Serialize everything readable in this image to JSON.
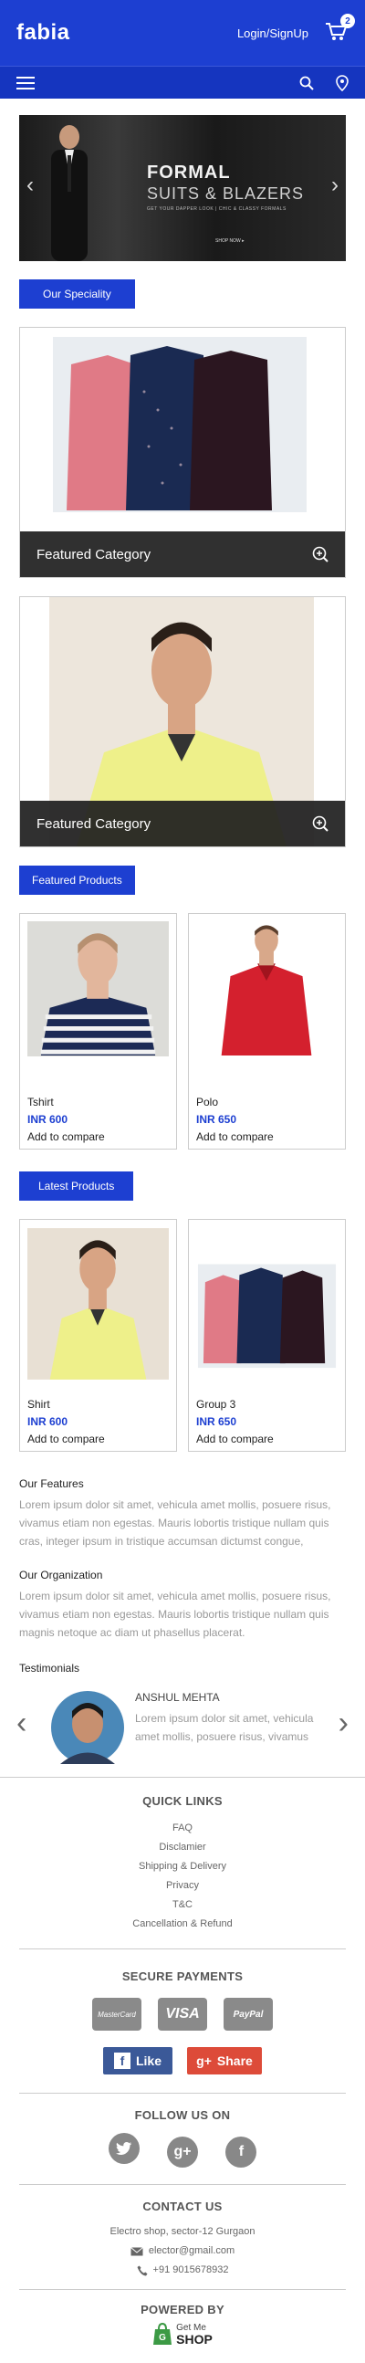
{
  "header": {
    "logo": "fabia",
    "login": "Login/SignUp",
    "cart_count": "2"
  },
  "banner": {
    "title": "FORMAL",
    "subtitle": "SUITS & BLAZERS",
    "tagline": "GET YOUR DAPPER LOOK | CHIC & CLASSY FORMALS",
    "cta": "SHOP NOW ▸"
  },
  "specialty": {
    "button": "Our Speciality",
    "cards": [
      {
        "label": "Featured Category"
      },
      {
        "label": "Featured Category"
      }
    ]
  },
  "featured_products": {
    "button": "Featured Products",
    "items": [
      {
        "name": "Tshirt",
        "price": "INR 600",
        "compare": "Add to compare"
      },
      {
        "name": "Polo",
        "price": "INR 650",
        "compare": "Add to compare"
      }
    ]
  },
  "latest_products": {
    "button": "Latest Products",
    "items": [
      {
        "name": "Shirt",
        "price": "INR 600",
        "compare": "Add to compare"
      },
      {
        "name": "Group 3",
        "price": "INR 650",
        "compare": "Add to compare"
      }
    ]
  },
  "features": {
    "heading": "Our Features",
    "text": "Lorem ipsum dolor sit amet, vehicula amet mollis, posuere risus, vivamus etiam non egestas. Mauris lobortis tristique nullam quis cras, integer ipsum in tristique accumsan dictumst congue,"
  },
  "organization": {
    "heading": "Our Organization",
    "text": "Lorem ipsum dolor sit amet, vehicula amet mollis, posuere risus, vivamus etiam non egestas. Mauris lobortis tristique nullam quis magnis netoque ac diam ut phasellus placerat."
  },
  "testimonials": {
    "heading": "Testimonials",
    "name": "ANSHUL MEHTA",
    "text": "Lorem ipsum dolor sit amet, vehicula amet mollis, posuere risus, vivamus"
  },
  "footer": {
    "quick_links_heading": "QUICK LINKS",
    "links": [
      "FAQ",
      "Disclamier",
      "Shipping & Delivery",
      "Privacy",
      "T&C",
      "Cancellation & Refund"
    ],
    "payments_heading": "SECURE PAYMENTS",
    "payments": [
      "MasterCard",
      "VISA",
      "PayPal"
    ],
    "like": "Like",
    "share": "Share",
    "follow_heading": "FOLLOW US ON",
    "contact_heading": "CONTACT US",
    "address": "Electro shop, sector-12 Gurgaon",
    "email": "elector@gmail.com",
    "phone": "+91 9015678932",
    "powered_heading": "POWERED BY",
    "powered_logo_top": "Get Me",
    "powered_logo_bottom": "SHOP"
  },
  "colors": {
    "primary": "#1d3fd1",
    "nav": "#1535bf",
    "facebook": "#3b5998",
    "gplus": "#dd4b39"
  }
}
